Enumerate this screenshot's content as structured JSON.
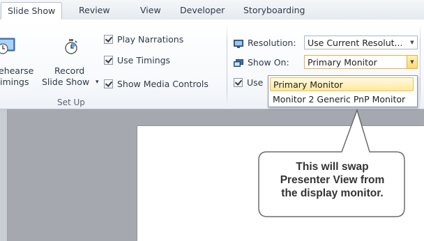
{
  "tabs": [
    {
      "label": "Slide Show",
      "active": true
    },
    {
      "label": "Review",
      "active": false
    },
    {
      "label": "View",
      "active": false
    },
    {
      "label": "Developer",
      "active": false
    },
    {
      "label": "Storyboarding",
      "active": false
    }
  ],
  "setup_group": {
    "rehearse_label_line1": "ehearse",
    "rehearse_label_line2": "imings",
    "record_label_line1": "Record",
    "record_label_line2": "Slide Show",
    "record_dropdown_glyph": "▾",
    "checkboxes": [
      {
        "label": "Play Narrations",
        "checked": true
      },
      {
        "label": "Use Timings",
        "checked": true
      },
      {
        "label": "Show Media Controls",
        "checked": true
      }
    ],
    "group_label": "Set Up"
  },
  "monitors_group": {
    "resolution_label": "Resolution:",
    "resolution_value": "Use Current Resolut...",
    "show_on_label": "Show On:",
    "show_on_value": "Primary Monitor",
    "presenter_checkbox_label": "Use",
    "presenter_checked": true
  },
  "dropdown": {
    "options": [
      {
        "label": "Primary Monitor",
        "highlighted": true
      },
      {
        "label": "Monitor 2 Generic PnP Monitor",
        "highlighted": false
      }
    ]
  },
  "callout": {
    "line1": "This will swap",
    "line2": "Presenter View from",
    "line3": "the display monitor."
  },
  "colors": {
    "workspace": "#a5a8ae",
    "highlight": "#ffe897",
    "callout_fill": "#ffffff",
    "callout_border": "#6b6b6b"
  },
  "icons": [
    "rehearse-timings-icon",
    "record-slideshow-icon",
    "resolution-icon",
    "show-on-monitor-icon"
  ]
}
